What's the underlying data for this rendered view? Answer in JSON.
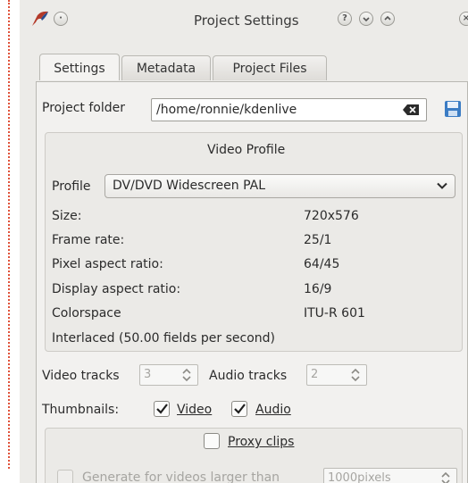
{
  "window": {
    "title": "Project Settings"
  },
  "tabs": [
    {
      "label": "Settings",
      "active": true
    },
    {
      "label": "Metadata",
      "active": false
    },
    {
      "label": "Project Files",
      "active": false
    }
  ],
  "project_folder": {
    "label": "Project folder",
    "value": "/home/ronnie/kdenlive"
  },
  "video_profile": {
    "heading": "Video Profile",
    "profile_label": "Profile",
    "profile_value": "DV/DVD Widescreen PAL",
    "rows": [
      {
        "label": "Size:",
        "value": "720x576"
      },
      {
        "label": "Frame rate:",
        "value": "25/1"
      },
      {
        "label": "Pixel aspect ratio:",
        "value": "64/45"
      },
      {
        "label": "Display aspect ratio:",
        "value": "16/9"
      },
      {
        "label": "Colorspace",
        "value": "ITU-R 601"
      }
    ],
    "interlaced": "Interlaced (50.00 fields per second)"
  },
  "tracks": {
    "video_label": "Video tracks",
    "video_value": "3",
    "audio_label": "Audio tracks",
    "audio_value": "2"
  },
  "thumbnails": {
    "label": "Thumbnails:",
    "video_label": "Video",
    "video_checked": true,
    "audio_label": "Audio",
    "audio_checked": true
  },
  "proxy": {
    "label": "Proxy clips",
    "checked": false,
    "generate_label": "Generate for videos larger than",
    "generate_value": "1000pixels"
  },
  "colors": {
    "accent": "#2f6fb5",
    "dotted_line": "#e0523a"
  }
}
